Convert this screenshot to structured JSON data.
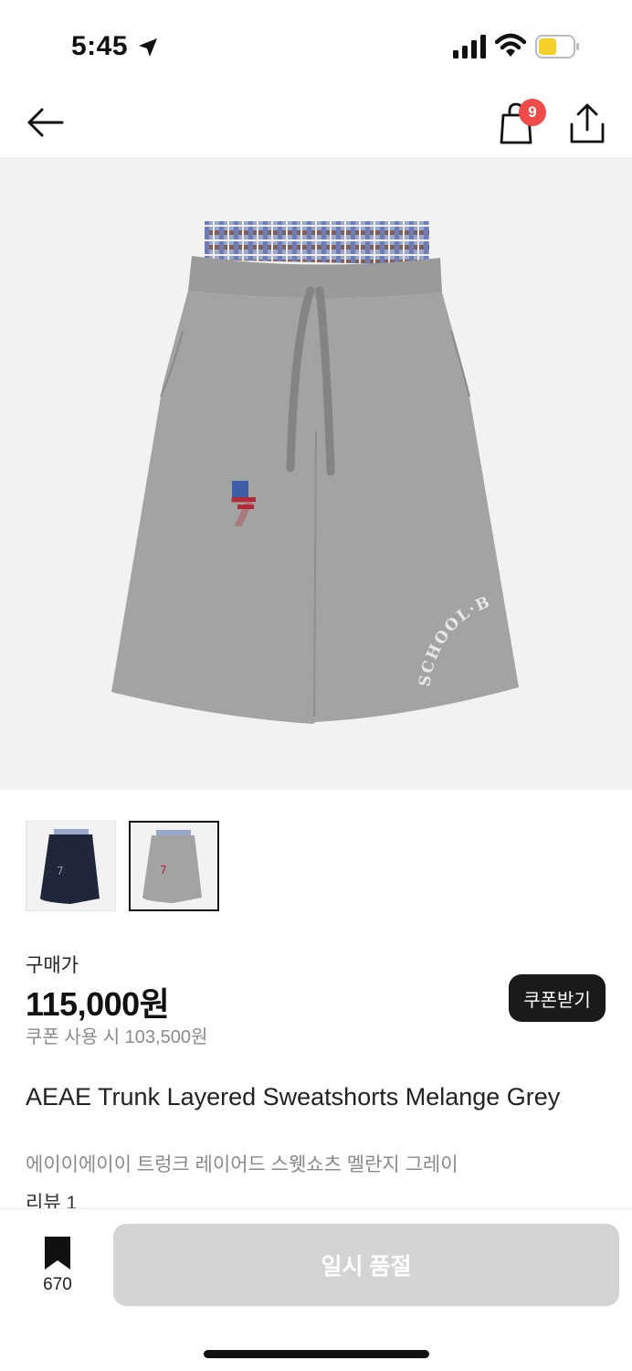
{
  "status_bar": {
    "time": "5:45"
  },
  "header": {
    "cart_count": "9"
  },
  "product": {
    "price_label": "구매가",
    "price": "115,000원",
    "coupon_price": "쿠폰 사용 시 103,500원",
    "coupon_button": "쿠폰받기",
    "name_en": "AEAE Trunk Layered Sweatshorts Melange Grey",
    "name_ko": "에이이에이이 트렁크 레이어드 스웻쇼츠 멜란지 그레이",
    "review": "리뷰 1",
    "graphic_text": "SCHOOL·BOY",
    "patch_number": "7"
  },
  "bottom_bar": {
    "bookmark_count": "670",
    "cta_label": "일시 품절"
  },
  "colors": {
    "badge": "#f04a49",
    "soldout": "#d4d4d4",
    "dark_button": "#1a1a1a"
  },
  "icons": [
    "location-arrow-icon",
    "signal-icon",
    "wifi-icon",
    "battery-icon",
    "back-arrow-icon",
    "shopping-bag-icon",
    "share-icon",
    "bookmark-icon"
  ]
}
